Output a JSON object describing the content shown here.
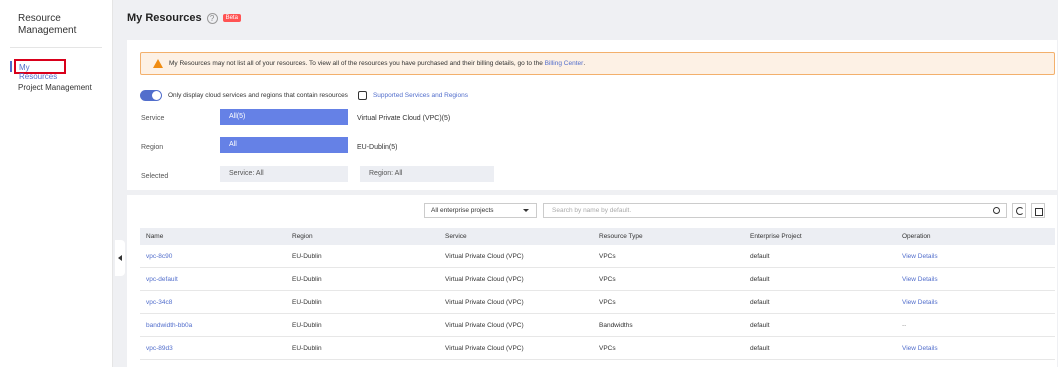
{
  "sidebar": {
    "title": "Resource Management",
    "items": [
      {
        "label": "My Resources"
      },
      {
        "label": "Project Management"
      }
    ]
  },
  "header": {
    "title": "My Resources",
    "help_icon": "?",
    "badge": "Beta"
  },
  "alert": {
    "text": "My Resources may not list all of your resources. To view all of the resources you have purchased and their billing details, go to the",
    "link": "Billing Center",
    "suffix": "."
  },
  "filters": {
    "toggle_label": "Only display cloud services and regions that contain resources",
    "supported_link": "Supported Services and Regions",
    "service_label": "Service",
    "service_selected": "All(5)",
    "service_option": "Virtual Private Cloud (VPC)(5)",
    "region_label": "Region",
    "region_selected": "All",
    "region_option": "EU-Dublin(5)",
    "selected_label": "Selected",
    "selected_service": "Service: All",
    "selected_region": "Region: All"
  },
  "toolbar": {
    "project_select": "All enterprise projects",
    "search_placeholder": "Search by name by default."
  },
  "table": {
    "headers": [
      "Name",
      "Region",
      "Service",
      "Resource Type",
      "Enterprise Project",
      "Operation"
    ],
    "rows": [
      {
        "name": "vpc-8c90",
        "region": "EU-Dublin",
        "service": "Virtual Private Cloud (VPC)",
        "type": "VPCs",
        "project": "default",
        "operation": "View Details"
      },
      {
        "name": "vpc-default",
        "region": "EU-Dublin",
        "service": "Virtual Private Cloud (VPC)",
        "type": "VPCs",
        "project": "default",
        "operation": "View Details"
      },
      {
        "name": "vpc-34c8",
        "region": "EU-Dublin",
        "service": "Virtual Private Cloud (VPC)",
        "type": "VPCs",
        "project": "default",
        "operation": "View Details"
      },
      {
        "name": "bandwidth-bb0a",
        "region": "EU-Dublin",
        "service": "Virtual Private Cloud (VPC)",
        "type": "Bandwidths",
        "project": "default",
        "operation": "--"
      },
      {
        "name": "vpc-89d3",
        "region": "EU-Dublin",
        "service": "Virtual Private Cloud (VPC)",
        "type": "VPCs",
        "project": "default",
        "operation": "View Details"
      }
    ]
  }
}
